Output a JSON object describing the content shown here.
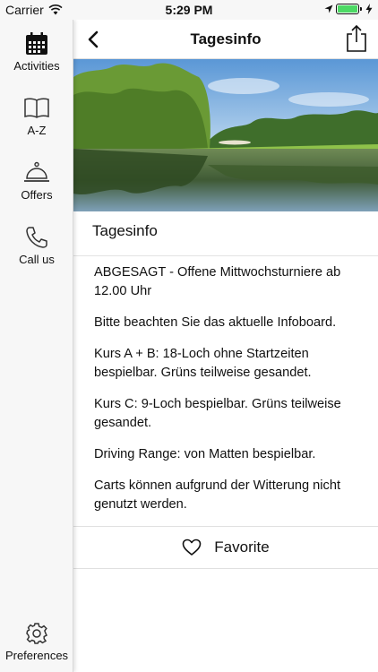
{
  "status_bar": {
    "carrier": "Carrier",
    "time": "5:29 PM",
    "battery_level": 1.0,
    "icons": [
      "wifi-icon",
      "location-arrow-icon",
      "battery-icon",
      "charging-bolt-icon"
    ]
  },
  "sidebar": {
    "items": [
      {
        "label": "Activities",
        "icon": "calendar-icon"
      },
      {
        "label": "A-Z",
        "icon": "book-icon"
      },
      {
        "label": "Offers",
        "icon": "service-bell-icon"
      },
      {
        "label": "Call us",
        "icon": "phone-icon"
      }
    ],
    "preferences": {
      "label": "Preferences",
      "icon": "gear-icon"
    }
  },
  "header": {
    "title": "Tagesinfo",
    "back_icon": "chevron-left-icon",
    "share_icon": "share-icon"
  },
  "hero": {
    "image": "golf-course-lake-photo"
  },
  "section": {
    "title": "Tagesinfo"
  },
  "content": {
    "paragraphs": [
      "ABGESAGT - Offene Mittwochsturniere ab 12.00 Uhr",
      "Bitte beachten Sie das aktuelle Infoboard.",
      "Kurs A + B: 18-Loch ohne Startzeiten bespielbar. Grüns teilweise gesandet.",
      "Kurs C: 9-Loch bespielbar. Grüns teilweise gesandet.",
      "Driving Range: von Matten bespielbar.",
      "Carts können aufgrund der Witterung nicht genutzt werden."
    ]
  },
  "favorite": {
    "label": "Favorite",
    "icon": "heart-icon"
  },
  "colors": {
    "battery_green": "#4cd964",
    "sidebar_bg": "#f7f7f7",
    "text": "#111111"
  }
}
